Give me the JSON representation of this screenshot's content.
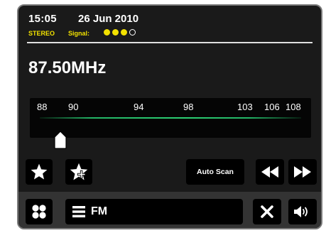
{
  "status": {
    "time": "15:05",
    "date": "26 Jun 2010",
    "stereo": "STEREO",
    "signal_label": "Signal:",
    "signal_level": 3,
    "signal_max": 4
  },
  "tuner": {
    "frequency": "87.50MHz",
    "scale_labels": [
      "88",
      "90",
      "94",
      "98",
      "103",
      "106",
      "108"
    ],
    "current_mhz": 87.5
  },
  "controls": {
    "favorite_icon": "star-icon",
    "add_favorite_icon": "star-plus-icon",
    "auto_scan_label": "Auto Scan",
    "seek_back_icon": "rewind-icon",
    "seek_forward_icon": "fast-forward-icon"
  },
  "bottom": {
    "menu_icon": "grid-icon",
    "list_icon": "list-icon",
    "mode_label": "FM",
    "close_icon": "close-icon",
    "volume_icon": "volume-icon"
  },
  "colors": {
    "accent_yellow": "#f2e100",
    "tuner_green": "#2ccf73",
    "panel": "#1a1a1a",
    "bottom_bar": "#333333"
  }
}
